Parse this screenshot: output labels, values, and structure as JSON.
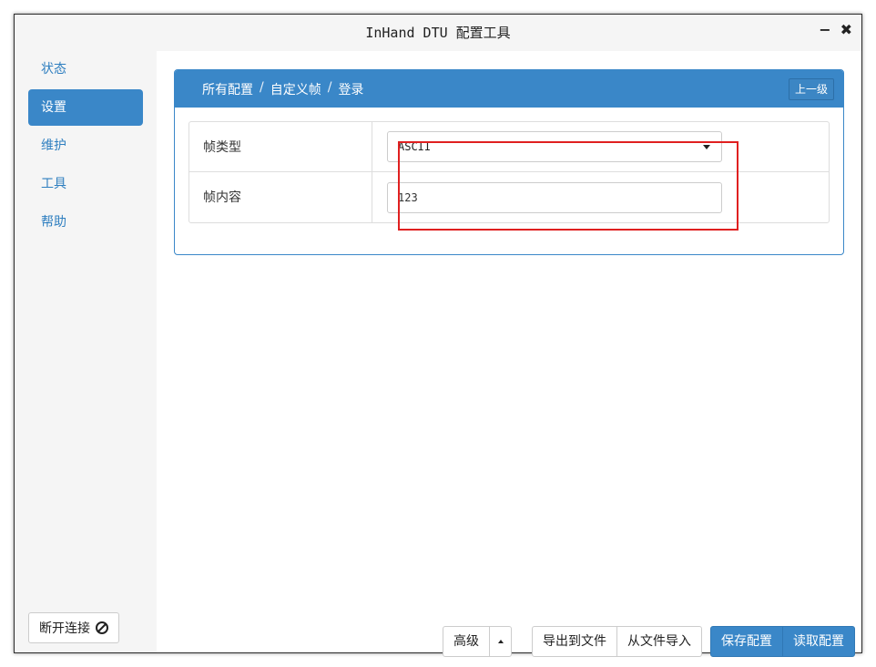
{
  "window": {
    "title": "InHand DTU 配置工具",
    "minimize_glyph": "−",
    "close_glyph": "✖"
  },
  "sidebar": {
    "items": [
      {
        "label": "状态",
        "active": false
      },
      {
        "label": "设置",
        "active": true
      },
      {
        "label": "维护",
        "active": false
      },
      {
        "label": "工具",
        "active": false
      },
      {
        "label": "帮助",
        "active": false
      }
    ],
    "disconnect_label": "断开连接",
    "disconnect_icon": "ban-icon"
  },
  "panel": {
    "breadcrumb": [
      "所有配置",
      "自定义帧",
      "登录"
    ],
    "breadcrumb_separator": "/",
    "up_button": "上一级"
  },
  "form": {
    "frame_type_label": "帧类型",
    "frame_type_value": "ASCII",
    "frame_content_label": "帧内容",
    "frame_content_value": "123"
  },
  "footer": {
    "advanced": "高级",
    "export_to_file": "导出到文件",
    "import_from_file": "从文件导入",
    "save_config": "保存配置",
    "read_config": "读取配置"
  },
  "colors": {
    "accent": "#3a87c8",
    "highlight": "#e02020"
  }
}
